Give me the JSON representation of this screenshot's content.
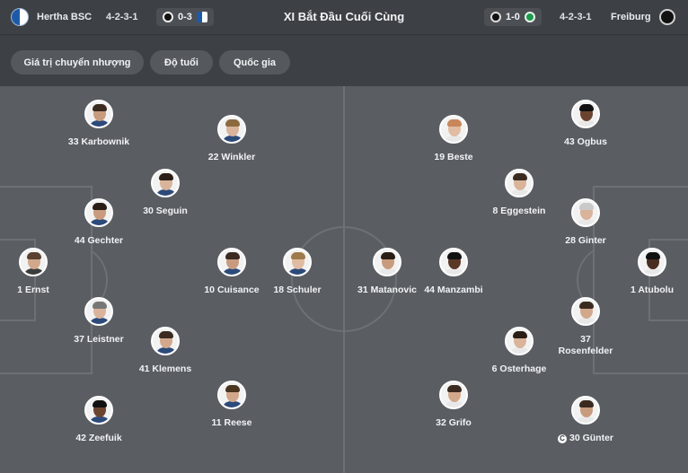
{
  "header": {
    "title": "XI Bắt Đầu Cuối Cùng",
    "home": {
      "name": "Hertha BSC",
      "formation": "4-2-3-1",
      "last_result": "0-3",
      "crest_color": "#1e5aa8"
    },
    "away": {
      "name": "Freiburg",
      "formation": "4-2-3-1",
      "last_result": "1-0",
      "crest_color": "#111111"
    }
  },
  "filters": {
    "market_value": "Giá trị chuyển nhượng",
    "age": "Độ tuổi",
    "nationality": "Quốc gia"
  },
  "lineup": {
    "home": [
      {
        "label": "33 Karbownik"
      },
      {
        "label": "22 Winkler"
      },
      {
        "label": "30 Seguin"
      },
      {
        "label": "44 Gechter"
      },
      {
        "label": "1 Ernst"
      },
      {
        "label": "10 Cuisance"
      },
      {
        "label": "18 Schuler"
      },
      {
        "label": "37 Leistner"
      },
      {
        "label": "41 Klemens"
      },
      {
        "label": "11 Reese"
      },
      {
        "label": "42 Zeefuik"
      }
    ],
    "away": [
      {
        "label": "19 Beste"
      },
      {
        "label": "43 Ogbus"
      },
      {
        "label": "8 Eggestein"
      },
      {
        "label": "28 Ginter"
      },
      {
        "label": "31 Matanovic"
      },
      {
        "label": "44 Manzambi"
      },
      {
        "label": "1 Atubolu"
      },
      {
        "label": "37 Rosenfelder"
      },
      {
        "label": "6 Osterhage"
      },
      {
        "label": "32 Grifo"
      },
      {
        "label": "30 Günter",
        "badge": "C"
      }
    ]
  },
  "colors": {
    "pitch": "#5a5e63",
    "header_bg": "#3d4044",
    "pitch_lines": "#6d7176",
    "chip_bg": "#55595e",
    "text": "#f1f3f5"
  }
}
